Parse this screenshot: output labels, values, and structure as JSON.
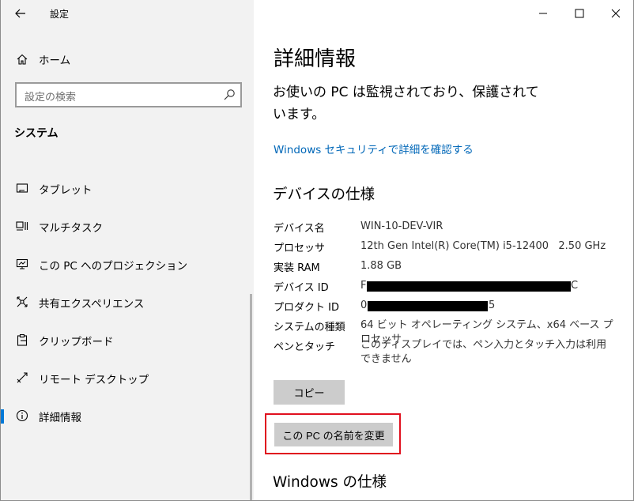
{
  "window": {
    "title": "設定",
    "controls": {
      "minimize": "minimize",
      "maximize": "maximize",
      "close": "close"
    }
  },
  "sidebar": {
    "home_label": "ホーム",
    "search": {
      "placeholder": "設定の検索"
    },
    "section_label": "システム",
    "items": [
      {
        "label": "タブレット",
        "icon": "tablet-icon"
      },
      {
        "label": "マルチタスク",
        "icon": "multitask-icon"
      },
      {
        "label": "この PC へのプロジェクション",
        "icon": "projection-icon"
      },
      {
        "label": "共有エクスペリエンス",
        "icon": "shared-experience-icon"
      },
      {
        "label": "クリップボード",
        "icon": "clipboard-icon"
      },
      {
        "label": "リモート デスクトップ",
        "icon": "remote-desktop-icon"
      },
      {
        "label": "詳細情報",
        "icon": "info-icon",
        "active": true
      }
    ]
  },
  "main": {
    "title": "詳細情報",
    "protection_text": "お使いの PC は監視されており、保護されています。",
    "security_link": "Windows セキュリティで詳細を確認する",
    "device_specs_heading": "デバイスの仕様",
    "specs": [
      {
        "key": "デバイス名",
        "value": "WIN-10-DEV-VIR"
      },
      {
        "key": "プロセッサ",
        "value": "12th Gen Intel(R) Core(TM) i5-12400   2.50 GHz"
      },
      {
        "key": "実装 RAM",
        "value": "1.88 GB"
      },
      {
        "key": "デバイス ID",
        "value_prefix": "F",
        "value_suffix": "C",
        "redacted": true
      },
      {
        "key": "プロダクト ID",
        "value_prefix": "0",
        "value_suffix": "5",
        "redacted": true
      },
      {
        "key": "システムの種類",
        "value": "64 ビット オペレーティング システム、x64 ベース プロセッサ"
      },
      {
        "key": "ペンとタッチ",
        "value": "このディスプレイでは、ペン入力とタッチ入力は利用できません"
      }
    ],
    "copy_button": "コピー",
    "rename_button": "この PC の名前を変更",
    "windows_specs_heading": "Windows の仕様"
  },
  "colors": {
    "accent": "#0078d7",
    "link": "#0067b8",
    "highlight": "#e0101e",
    "sidebar_bg": "#f2f2f2",
    "button_bg": "#cccccc"
  }
}
